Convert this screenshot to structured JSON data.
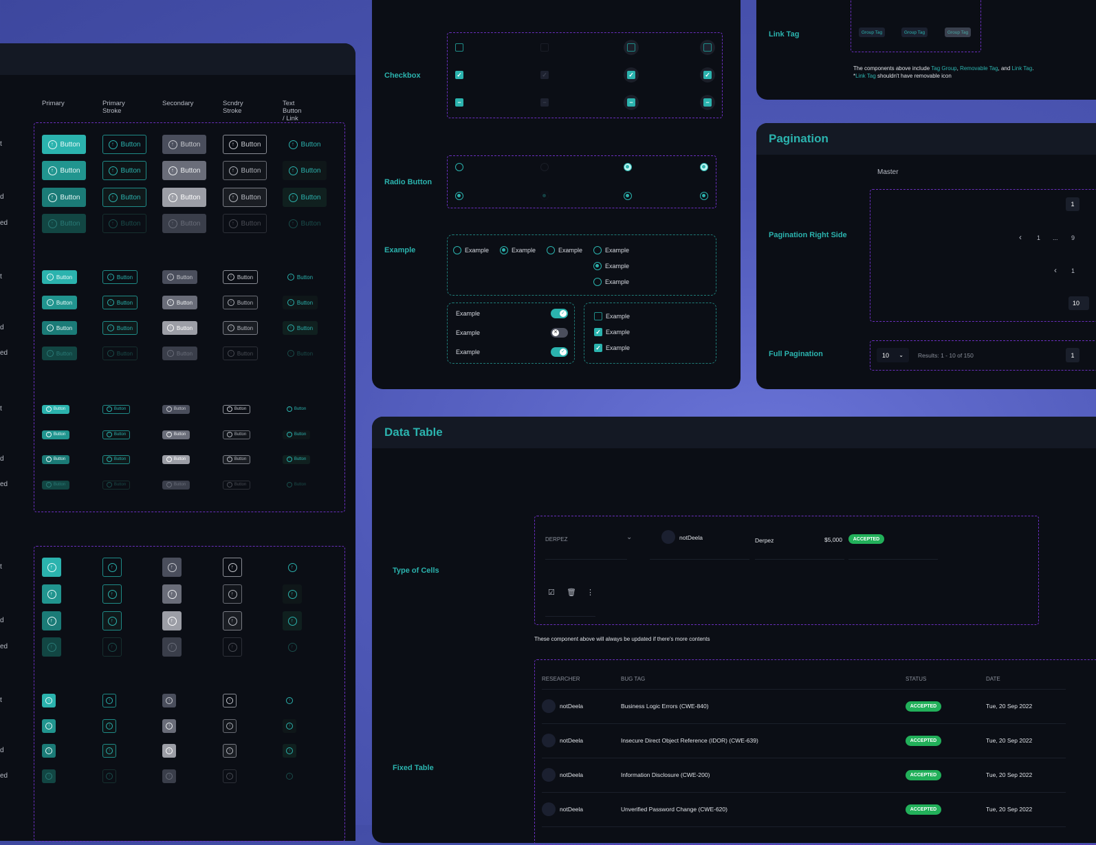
{
  "buttons": {
    "columns": [
      "Primary",
      "Primary Stroke",
      "Secondary",
      "Scndry Stroke",
      "Text Button / Link"
    ],
    "row_labels_visible": [
      "t",
      "",
      "d",
      "ed"
    ],
    "label": "Button",
    "icon": "arrow-up-circle-icon"
  },
  "selection": {
    "checkbox_label": "Checkbox",
    "radio_label": "Radio Button",
    "example_label": "Example",
    "item_label": "Example",
    "toggles": [
      true,
      false,
      true
    ],
    "checks": [
      false,
      true,
      true
    ]
  },
  "tags": {
    "section": "Link Tag",
    "tag_label": "Group Tag",
    "note_prefix": "The components above include ",
    "note_link1": "Tag Group",
    "note_sep1": ", ",
    "note_link2": "Removable Tag",
    "note_sep2": ", and ",
    "note_link3": "Link Tag",
    "note_end": ".",
    "note2_prefix": "*",
    "note2_link": "Link Tag",
    "note2_rest": " shouldn't have removable icon"
  },
  "pagination": {
    "title": "Pagination",
    "master": "Master",
    "right_side_label": "Pagination Right Side",
    "full_label": "Full Pagination",
    "page_1": "1",
    "ellipsis": "...",
    "page_9": "9",
    "page_10": "10",
    "per_page": "10",
    "results": "Results: 1 - 10 of 150"
  },
  "data_table": {
    "title": "Data Table",
    "type_of_cells_label": "Type of Cells",
    "select_value": "DERPEZ",
    "cell_user": "notDeela",
    "cell_text": "Derpez",
    "cell_amount": "$5,000",
    "cell_badge": "ACCEPTED",
    "note": "These component above will always be updated if there's more contents",
    "fixed_table_label": "Fixed Table",
    "headers": [
      "RESEARCHER",
      "BUG TAG",
      "STATUS",
      "DATE"
    ],
    "rows": [
      {
        "researcher": "notDeela",
        "bug_tag": "Business Logic Errors (CWE-840)",
        "status": "ACCEPTED",
        "date": "Tue, 20 Sep 2022"
      },
      {
        "researcher": "notDeela",
        "bug_tag": "Insecure Direct Object Reference (IDOR) (CWE-639)",
        "status": "ACCEPTED",
        "date": "Tue, 20 Sep 2022"
      },
      {
        "researcher": "notDeela",
        "bug_tag": "Information Disclosure (CWE-200)",
        "status": "ACCEPTED",
        "date": "Tue, 20 Sep 2022"
      },
      {
        "researcher": "notDeela",
        "bug_tag": "Unverified Password Change (CWE-620)",
        "status": "ACCEPTED",
        "date": "Tue, 20 Sep 2022"
      }
    ]
  },
  "colors": {
    "accent": "#2bb3ae",
    "success": "#22b05a",
    "dash": "#6b2fc0",
    "panel": "#0b0e15"
  }
}
